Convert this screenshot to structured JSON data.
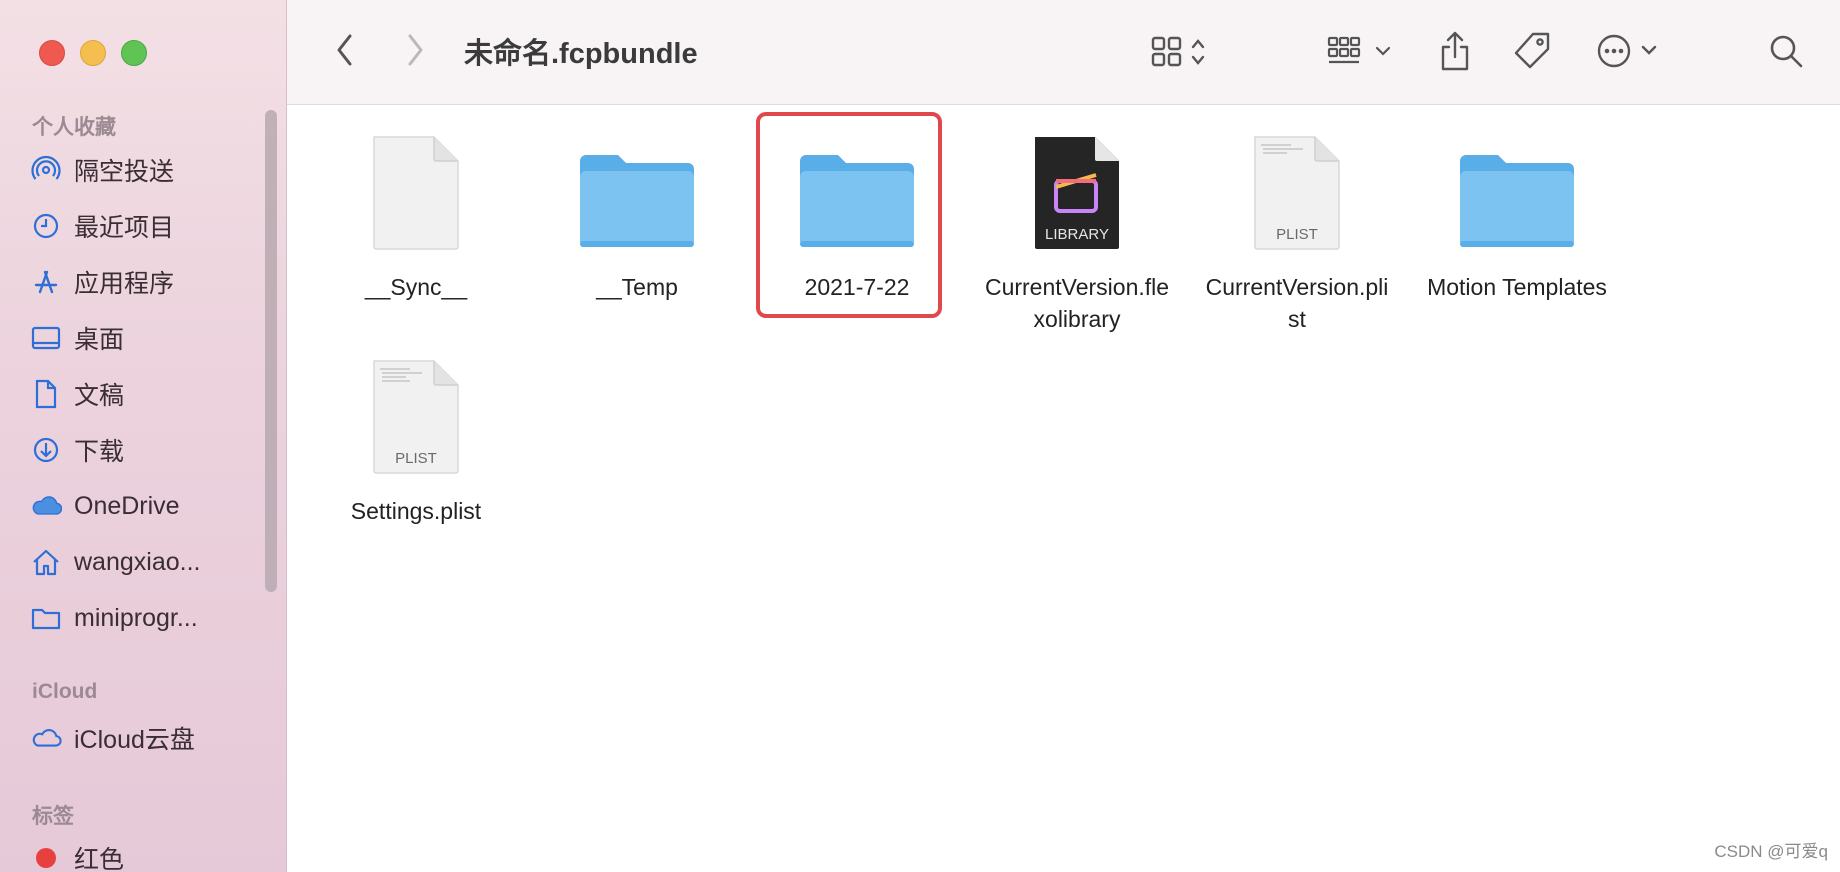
{
  "window": {
    "title": "未命名.fcpbundle"
  },
  "sidebar": {
    "favorites_header": "个人收藏",
    "items": [
      {
        "label": "隔空投送",
        "icon": "airdrop-icon"
      },
      {
        "label": "最近项目",
        "icon": "clock-icon"
      },
      {
        "label": "应用程序",
        "icon": "applications-icon"
      },
      {
        "label": "桌面",
        "icon": "desktop-icon"
      },
      {
        "label": "文稿",
        "icon": "document-icon"
      },
      {
        "label": "下载",
        "icon": "download-icon"
      },
      {
        "label": "OneDrive",
        "icon": "cloud-icon"
      },
      {
        "label": "wangxiao...",
        "icon": "home-icon"
      },
      {
        "label": "miniprogr...",
        "icon": "folder-icon"
      }
    ],
    "icloud_header": "iCloud",
    "icloud_items": [
      {
        "label": "iCloud云盘",
        "icon": "icloud-icon"
      }
    ],
    "tags_header": "标签",
    "tag_items": [
      {
        "label": "红色",
        "color": "#e8403f"
      }
    ]
  },
  "files": [
    {
      "name": "__Sync__",
      "kind": "document"
    },
    {
      "name": "__Temp",
      "kind": "folder"
    },
    {
      "name": "2021-7-22",
      "kind": "folder",
      "highlighted": true
    },
    {
      "name": "CurrentVersion.flexolibrary",
      "display": [
        "CurrentVersion.fle",
        "xolibrary"
      ],
      "kind": "library",
      "badge": "LIBRARY"
    },
    {
      "name": "CurrentVersion.plist",
      "display": [
        "CurrentVersion.pli",
        "st"
      ],
      "kind": "plist",
      "badge": "PLIST"
    },
    {
      "name": "Motion Templates",
      "kind": "folder"
    },
    {
      "name": "Settings.plist",
      "kind": "plist",
      "badge": "PLIST"
    }
  ],
  "watermark": "CSDN @可爱q",
  "colors": {
    "folder": "#7cc3f2",
    "highlight": "#e0484d",
    "accent": "#2d6fd6"
  }
}
